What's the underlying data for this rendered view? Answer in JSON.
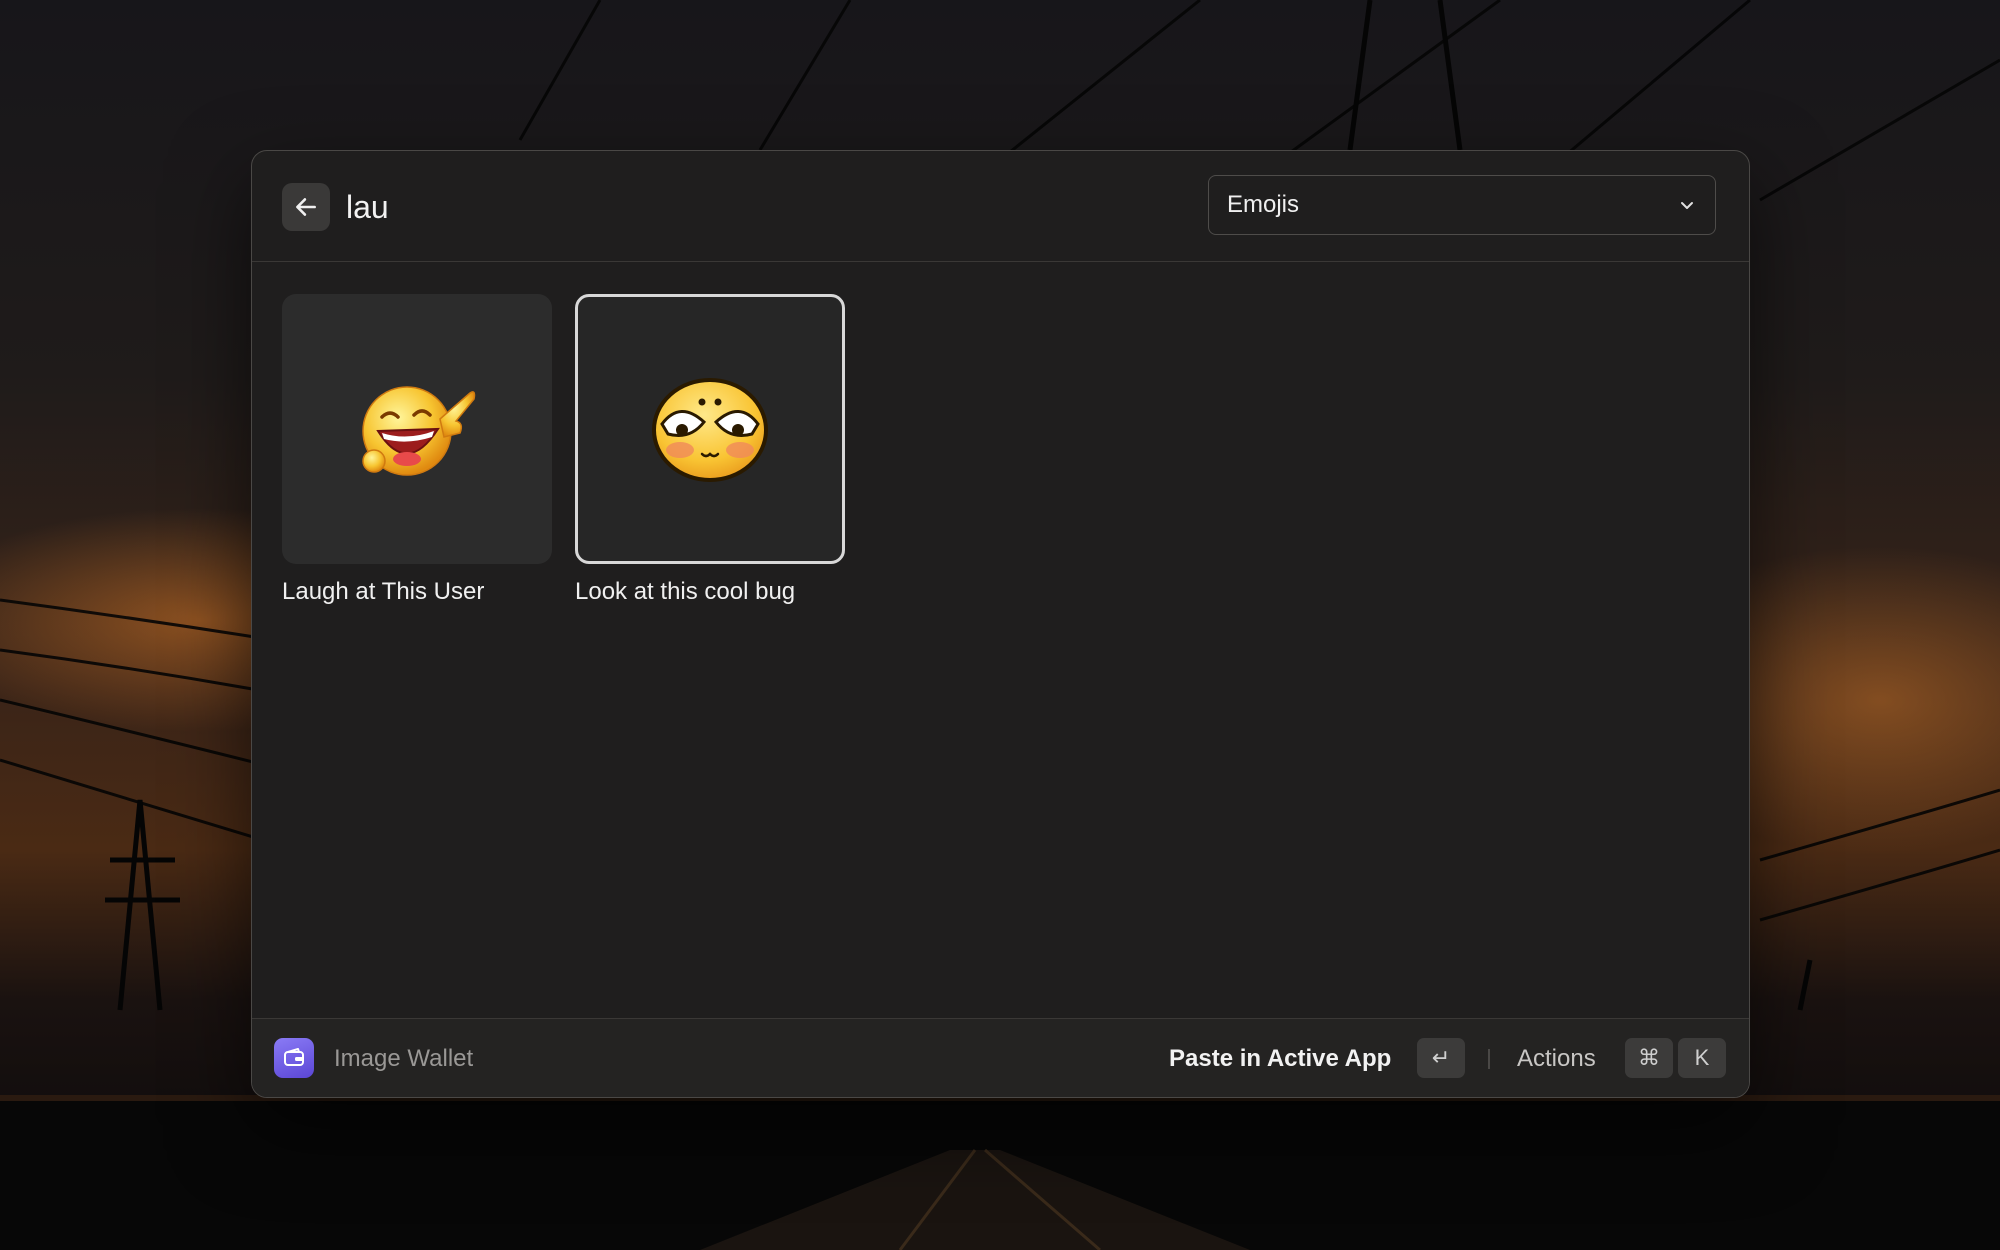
{
  "search": {
    "value": "lau",
    "back_icon": "arrow-left-icon"
  },
  "filter": {
    "selected": "Emojis",
    "icon": "chevron-down-icon"
  },
  "items": [
    {
      "label": "Laugh at This User",
      "icon": "laughing-pointing-emoji",
      "selected": false
    },
    {
      "label": "Look at this cool bug",
      "icon": "blushing-cute-emoji",
      "selected": true
    }
  ],
  "footer": {
    "app_icon": "wallet-icon",
    "app_name": "Image Wallet",
    "primary_action": "Paste in Active App",
    "primary_key": "↵",
    "actions_label": "Actions",
    "actions_keys": [
      "⌘",
      "K"
    ]
  },
  "colors": {
    "accent": "#6c5ce7",
    "background": "#1f1e1e"
  }
}
